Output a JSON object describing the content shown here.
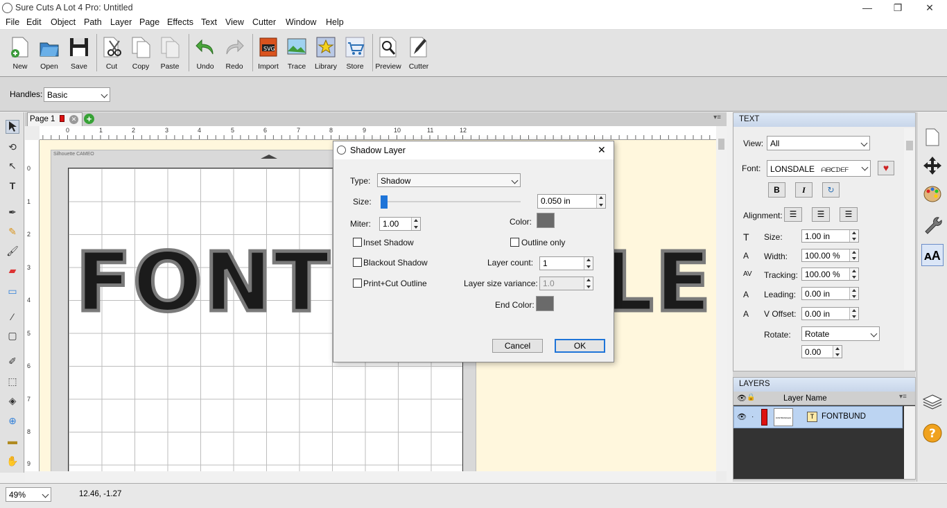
{
  "window": {
    "title": "Sure Cuts A Lot 4 Pro: Untitled",
    "min": "—",
    "max": "❐",
    "close": "✕"
  },
  "menu": [
    "File",
    "Edit",
    "Object",
    "Path",
    "Layer",
    "Page",
    "Effects",
    "Text",
    "View",
    "Cutter",
    "Window",
    "Help"
  ],
  "toolbar": [
    {
      "label": "New",
      "icon": "new-doc-icon"
    },
    {
      "label": "Open",
      "icon": "open-folder-icon"
    },
    {
      "label": "Save",
      "icon": "floppy-disk-icon"
    },
    {
      "label": "Cut",
      "icon": "scissors-icon"
    },
    {
      "label": "Copy",
      "icon": "copy-icon"
    },
    {
      "label": "Paste",
      "icon": "paste-icon"
    },
    {
      "label": "Undo",
      "icon": "undo-arrow-icon"
    },
    {
      "label": "Redo",
      "icon": "redo-arrow-icon"
    },
    {
      "label": "Import",
      "icon": "svg-import-icon"
    },
    {
      "label": "Trace",
      "icon": "trace-image-icon"
    },
    {
      "label": "Library",
      "icon": "star-library-icon"
    },
    {
      "label": "Store",
      "icon": "cart-icon"
    },
    {
      "label": "Preview",
      "icon": "magnifier-doc-icon"
    },
    {
      "label": "Cutter",
      "icon": "pen-cutter-icon"
    }
  ],
  "options": {
    "handles_label": "Handles:",
    "handles_value": "Basic"
  },
  "page": {
    "tab_label": "Page 1",
    "mat_label": "Silhouette CAMEO",
    "word": "FONTBUNDLES",
    "ruler_top": [
      "0",
      "1",
      "2",
      "3",
      "4",
      "5",
      "6",
      "7",
      "8",
      "9",
      "10",
      "11",
      "12"
    ],
    "ruler_left": [
      "0",
      "1",
      "2",
      "3",
      "4",
      "5",
      "6",
      "7",
      "8",
      "9"
    ]
  },
  "dialog": {
    "title": "Shadow Layer",
    "close": "✕",
    "type_label": "Type:",
    "type_value": "Shadow",
    "size_label": "Size:",
    "size_value": "0.050 in",
    "miter_label": "Miter:",
    "miter_value": "1.00",
    "color_label": "Color:",
    "inset_label": "Inset Shadow",
    "outline_label": "Outline only",
    "blackout_label": "Blackout Shadow",
    "layercount_label": "Layer count:",
    "layercount_value": "1",
    "printcut_label": "Print+Cut Outline",
    "variance_label": "Layer size variance:",
    "variance_value": "1.0",
    "endcolor_label": "End Color:",
    "cancel": "Cancel",
    "ok": "OK",
    "shadow_color": "#6a6a6a"
  },
  "text_panel": {
    "header": "TEXT",
    "view_label": "View:",
    "view_value": "All",
    "font_label": "Font:",
    "font_value": "LONSDALE",
    "font_preview": "ᗩᗷᑕᗪᗴᖴ",
    "bold": "B",
    "italic": "I",
    "alignment_label": "Alignment:",
    "size_label": "Size:",
    "size_value": "1.00 in",
    "width_label": "Width:",
    "width_value": "100.00 %",
    "tracking_label": "Tracking:",
    "tracking_value": "100.00 %",
    "leading_label": "Leading:",
    "leading_value": "0.00 in",
    "voffset_label": "V Offset:",
    "voffset_value": "0.00 in",
    "rotate_label": "Rotate:",
    "rotate_value": "Rotate",
    "rotate_amount": "0.00"
  },
  "layers_panel": {
    "header": "LAYERS",
    "col_name": "Layer Name",
    "layer_name": "FONTBUND",
    "thumb_text": "FONTBUNDLES"
  },
  "status": {
    "zoom": "49%",
    "coords": "12.46, -1.27"
  }
}
